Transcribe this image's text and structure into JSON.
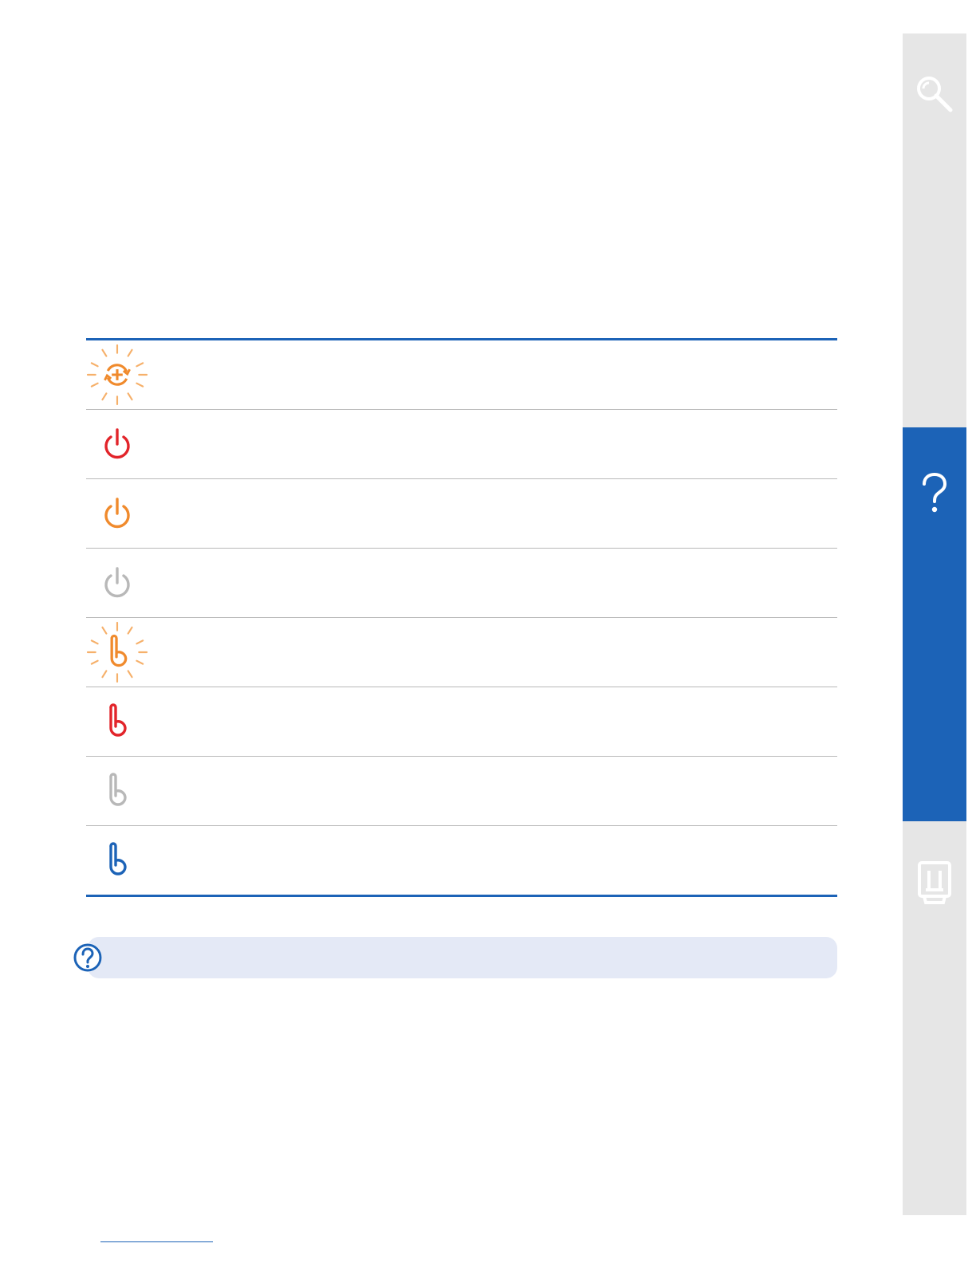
{
  "sidebar": {
    "tabs": [
      {
        "name": "search-tab",
        "icon": "search-icon"
      },
      {
        "name": "help-tab",
        "icon": "question-icon",
        "active": true,
        "color": "#1c63b7"
      },
      {
        "name": "product-tab",
        "icon": "printer-stand-icon"
      }
    ]
  },
  "status_table": {
    "rows": [
      {
        "icon": "refresh-plus-icon",
        "color": "#f08a2c",
        "blinking": true
      },
      {
        "icon": "power-icon",
        "color": "#e2242a",
        "blinking": false
      },
      {
        "icon": "power-icon",
        "color": "#f08a2c",
        "blinking": false
      },
      {
        "icon": "power-icon",
        "color": "#b8b8b8",
        "blinking": false
      },
      {
        "icon": "clip-icon",
        "color": "#f08a2c",
        "blinking": true
      },
      {
        "icon": "clip-icon",
        "color": "#e2242a",
        "blinking": false
      },
      {
        "icon": "clip-icon",
        "color": "#b8b8b8",
        "blinking": false
      },
      {
        "icon": "clip-icon",
        "color": "#1c63b7",
        "blinking": false
      }
    ]
  },
  "note": {
    "icon": "question-circle-icon",
    "color": "#1c63b7",
    "background": "#e4e9f6"
  }
}
